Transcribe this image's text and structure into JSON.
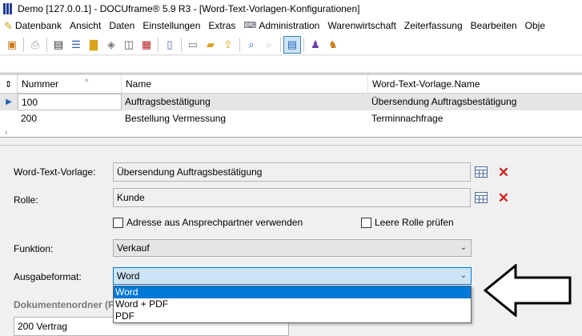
{
  "window": {
    "title": "Demo [127.0.0.1] - DOCUframe® 5.9 R3 - [Word-Text-Vorlagen-Konfigurationen]"
  },
  "menubar": {
    "items": [
      "Datenbank",
      "Ansicht",
      "Daten",
      "Einstellungen",
      "Extras",
      "Administration",
      "Warenwirtschaft",
      "Zeiterfassung",
      "Bearbeiten",
      "Obje"
    ]
  },
  "grid": {
    "columns": [
      "Nummer",
      "Name",
      "Word-Text-Vorlage.Name"
    ],
    "rows": [
      {
        "nummer": "100",
        "name": "Auftragsbestätigung",
        "vorlage": "Übersendung Auftragsbestätigung"
      },
      {
        "nummer": "200",
        "name": "Bestellung Vermessung",
        "vorlage": "Terminnachfrage"
      }
    ]
  },
  "form": {
    "vorlage_label": "Word-Text-Vorlage:",
    "vorlage_value": "Übersendung Auftragsbestätigung",
    "rolle_label": "Rolle:",
    "rolle_value": "Kunde",
    "cb_adresse": "Adresse aus Ansprechpartner verwenden",
    "cb_leere_rolle": "Leere Rolle prüfen",
    "funktion_label": "Funktion:",
    "funktion_value": "Verkauf",
    "ausgabe_label": "Ausgabeformat:",
    "ausgabe_value": "Word",
    "ausgabe_options": [
      "Word",
      "Word + PDF",
      "PDF"
    ],
    "ordner_label": "Dokumentenordner (F",
    "ordner_value": "200 Vertrag"
  }
}
